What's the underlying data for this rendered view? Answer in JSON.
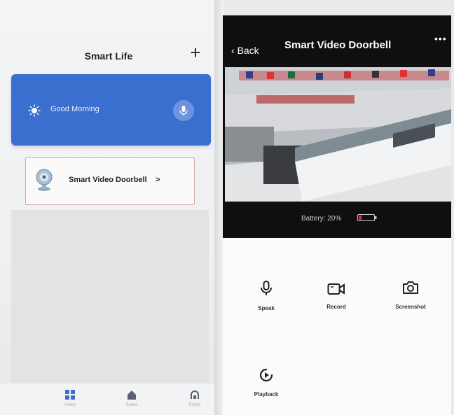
{
  "left_app": {
    "title": "Smart Life",
    "add_icon": "plus-icon",
    "greeting": {
      "text": "Good Morning",
      "weather_icon": "sun-icon",
      "action_icon": "microphone-icon",
      "background": "#3b6fcf"
    },
    "device": {
      "name": "Smart Video Doorbell",
      "chevron": ">",
      "icon": "camera-device-icon"
    },
    "bottom_nav": [
      {
        "label": "Home",
        "icon": "grid-icon"
      },
      {
        "label": "Scene",
        "icon": "house-icon"
      },
      {
        "label": "Profile",
        "icon": "profile-icon"
      }
    ]
  },
  "right_app": {
    "back_label": "Back",
    "title": "Smart  Video Doorbell",
    "more_label": "•••",
    "battery_text": "Battery: 20%",
    "battery_level": 0.2,
    "battery_color": "#e0243a",
    "controls": [
      {
        "label": "Speak",
        "icon": "microphone-icon"
      },
      {
        "label": "Record",
        "icon": "video-camera-icon"
      },
      {
        "label": "Screenshot",
        "icon": "camera-icon"
      },
      {
        "label": "Playback",
        "icon": "playback-icon"
      }
    ]
  }
}
